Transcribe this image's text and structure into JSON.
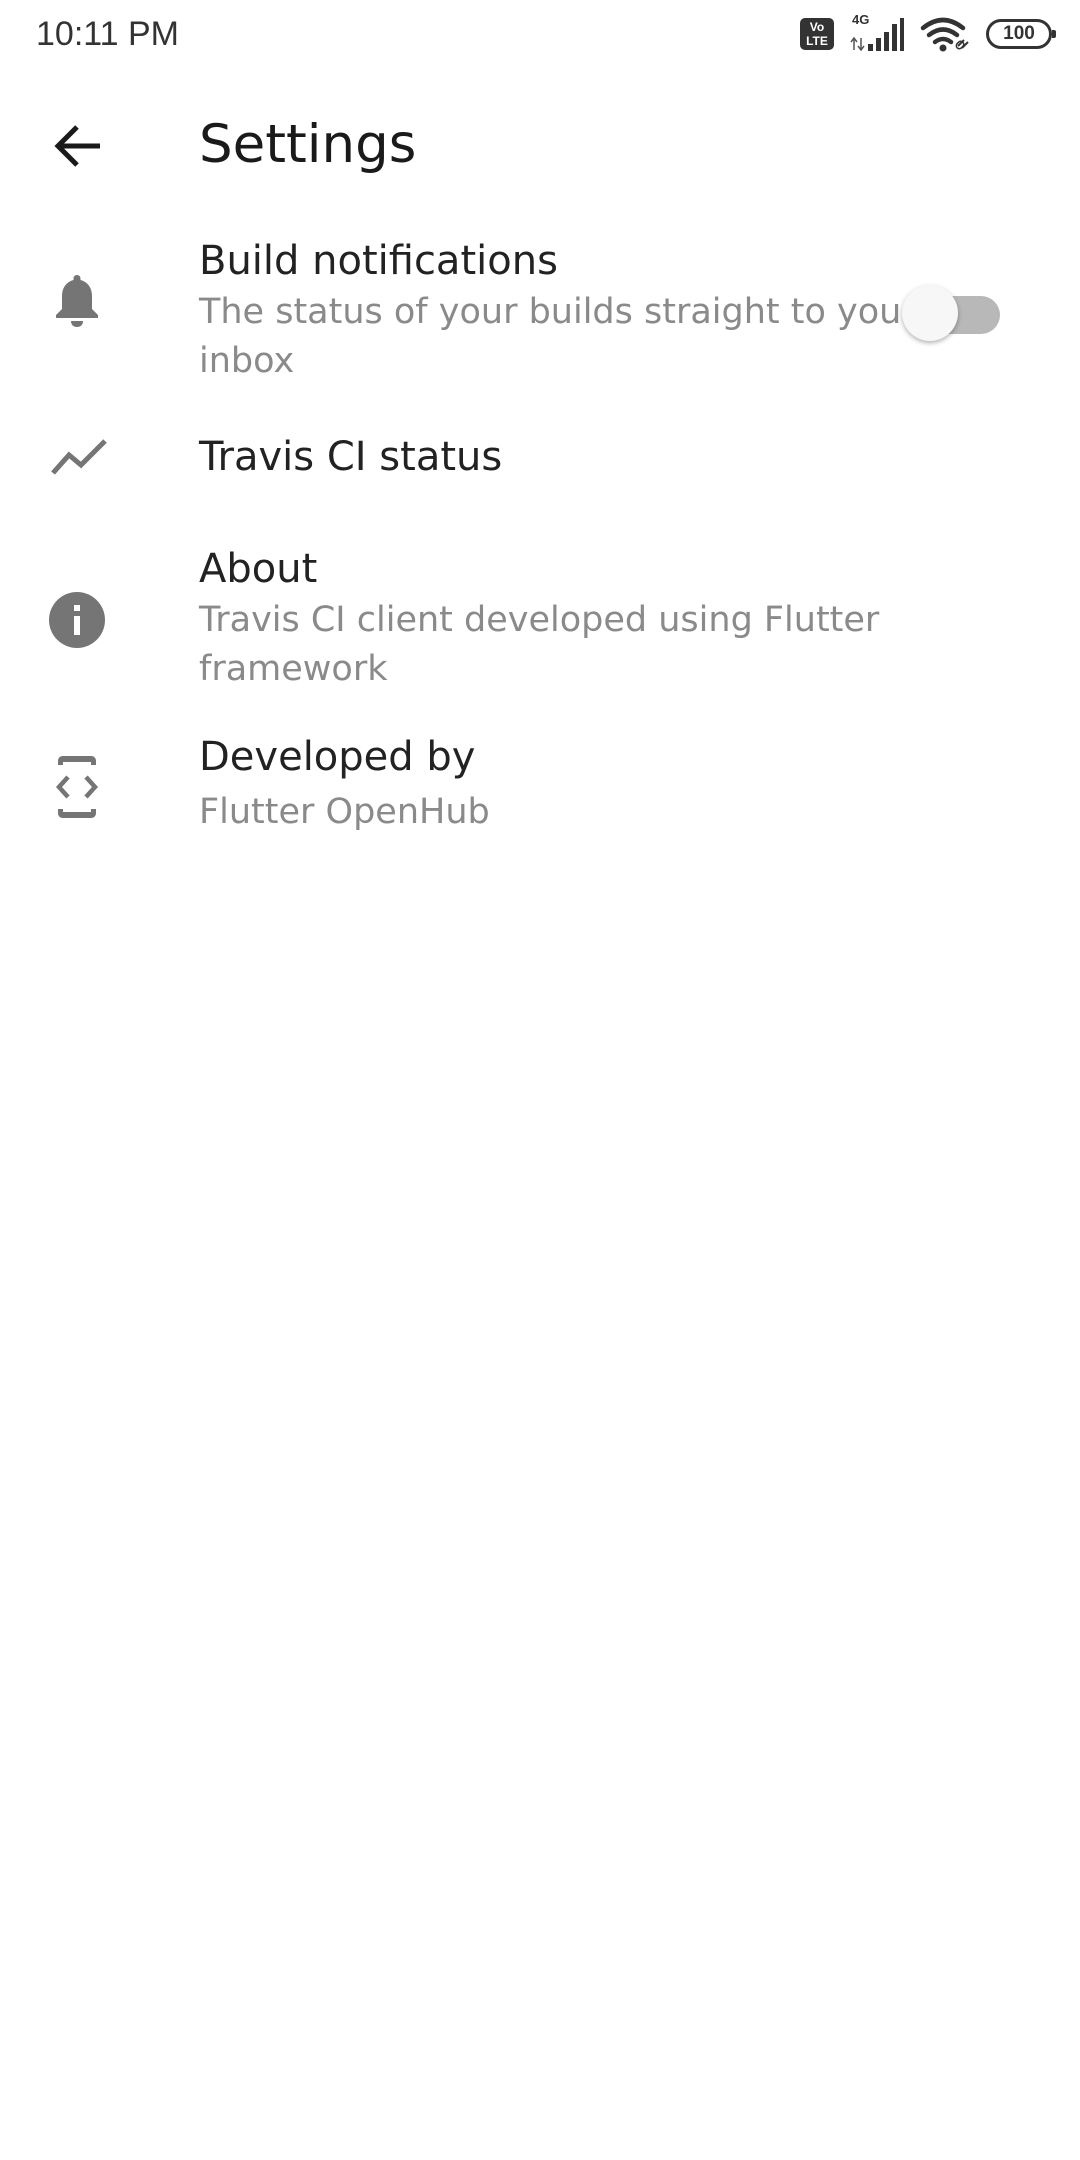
{
  "status_bar": {
    "time": "10:11 PM",
    "volte_label_top": "Vo",
    "volte_label_bottom": "LTE",
    "network_type": "4G",
    "battery_level": "100"
  },
  "app_bar": {
    "title": "Settings",
    "back_icon": "arrow-left-icon"
  },
  "settings": {
    "items": [
      {
        "icon": "bell-icon",
        "title": "Build notifications",
        "subtitle": "The status of your builds straight to your inbox",
        "toggle_on": false
      },
      {
        "icon": "trending-up-icon",
        "title": "Travis CI status"
      },
      {
        "icon": "info-icon",
        "title": "About",
        "subtitle": "Travis CI client developed using Flutter framework"
      },
      {
        "icon": "developer-mode-icon",
        "title": "Developed by",
        "subtitle": "Flutter OpenHub"
      }
    ]
  },
  "colors": {
    "icon_gray": "#757575",
    "title_text": "#222222",
    "subtitle_text": "#8a8a8a",
    "toggle_track_off": "#b8b8b8",
    "toggle_thumb_off": "#f7f7f7"
  }
}
